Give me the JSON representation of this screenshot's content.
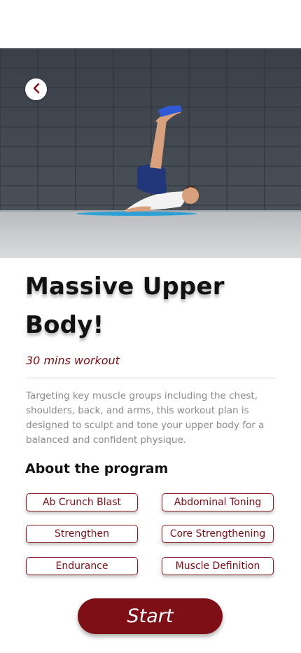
{
  "hero": {
    "image_name": "man-doing-leg-raise-workout",
    "back_icon": "chevron-left-icon"
  },
  "workout": {
    "title": "Massive Upper Body!",
    "duration": "30 mins workout",
    "description": "Targeting key muscle groups including the chest, shoulders, back, and arms, this workout plan is designed to sculpt and tone your upper body for a balanced and confident physique."
  },
  "program": {
    "heading": "About the program",
    "tags": [
      "Ab Crunch Blast",
      "Abdominal Toning",
      "Strengthen",
      "Core Strengthening",
      "Endurance",
      "Muscle Definition"
    ]
  },
  "actions": {
    "start_label": "Start"
  },
  "colors": {
    "accent": "#7f0f17",
    "accent_text": "#7a0d17",
    "description_text": "#8a8a8a"
  }
}
